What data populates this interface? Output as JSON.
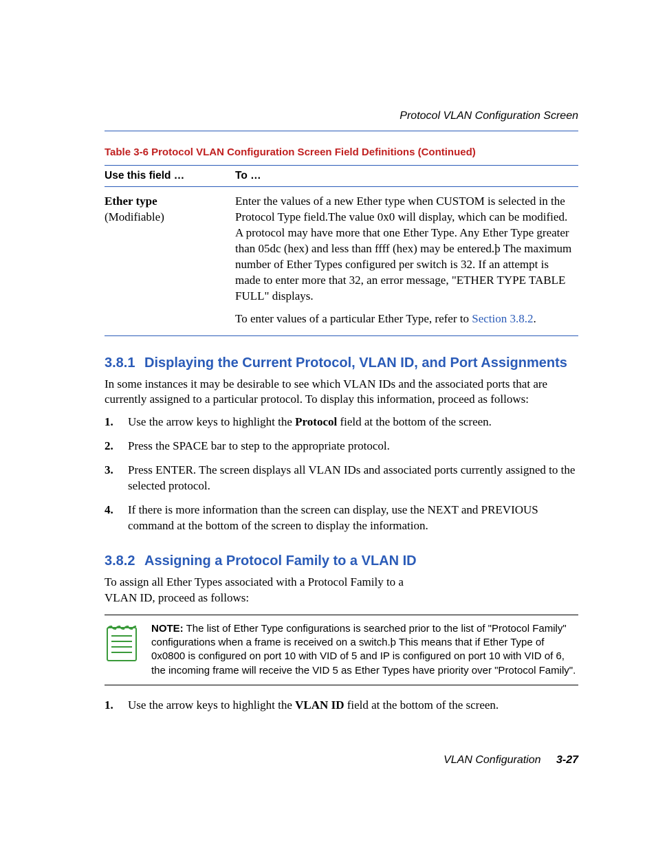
{
  "running_head": "Protocol VLAN Configuration Screen",
  "table": {
    "caption": "Table 3-6   Protocol VLAN Configuration Screen Field Definitions (Continued)",
    "head_col1": "Use this field …",
    "head_col2": "To …",
    "row": {
      "field_name": "Ether type",
      "field_mod": "(Modifiable)",
      "desc1": "Enter the values of a new Ether type when CUSTOM is selected in the Protocol Type field.The value 0x0 will display, which can be modified. A protocol may have more that one Ether Type. Any Ether Type greater than 05dc (hex) and less than ffff (hex) may be entered.þ The maximum number of Ether Types configured per switch is 32. If an attempt is made to enter more that 32, an error message, \"ETHER TYPE TABLE FULL\" displays.",
      "desc2_pre": "To enter values of a particular Ether Type, refer to ",
      "desc2_link": "Section 3.8.2",
      "desc2_post": "."
    }
  },
  "s381": {
    "num": "3.8.1",
    "title": "Displaying the Current Protocol, VLAN ID, and Port Assignments",
    "intro": "In some instances it may be desirable to see which VLAN IDs and the associated ports that are currently assigned to a particular protocol. To display this information, proceed as follows:",
    "steps": {
      "s1_pre": "Use the arrow keys to highlight the ",
      "s1_bold": "Protocol",
      "s1_post": " field at the bottom of the screen.",
      "s2": "Press the SPACE bar to step to the appropriate protocol.",
      "s3": "Press ENTER. The screen displays all VLAN IDs and associated ports currently assigned to the selected protocol.",
      "s4": "If there is more information than the screen can display, use the NEXT and PREVIOUS command at the bottom of the screen to display the information."
    }
  },
  "s382": {
    "num": "3.8.2",
    "title": "Assigning a Protocol Family to a VLAN ID",
    "intro": "To assign all Ether Types associated with a Protocol Family to a VLAN ID, proceed as follows:",
    "note_lead": "NOTE:",
    "note_body": "  The list of Ether Type configurations is searched prior to the list of \"Protocol Family\" configurations when a frame is received on a switch.þ This means that if Ether Type of 0x0800 is configured on port 10 with VID of 5 and IP is configured on port 10 with VID of 6, the incoming frame will receive the VID 5 as Ether Types have priority over \"Protocol Family\".",
    "steps": {
      "s1_pre": "Use the arrow keys to highlight the ",
      "s1_bold": "VLAN ID",
      "s1_post": " field at the bottom of the screen."
    }
  },
  "footer": {
    "chapter": "VLAN Configuration",
    "page": "3-27"
  }
}
